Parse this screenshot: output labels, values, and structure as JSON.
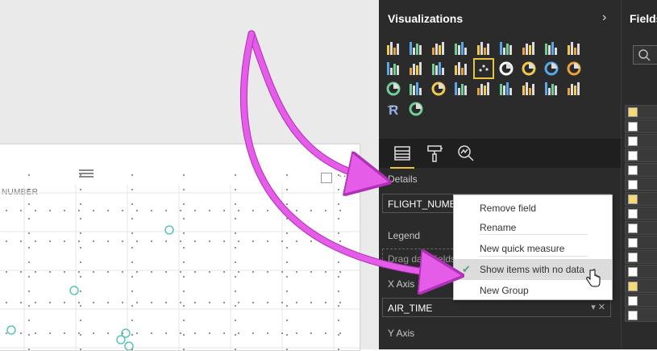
{
  "visualizations_pane": {
    "title": "Visualizations",
    "more_label": "...",
    "r_label": "R",
    "icons": [
      "stacked-bar-chart-icon",
      "stacked-column-chart-icon",
      "clustered-bar-chart-icon",
      "clustered-column-chart-icon",
      "100-stacked-bar-chart-icon",
      "100-stacked-column-chart-icon",
      "line-chart-icon",
      "area-chart-icon",
      "stacked-area-chart-icon",
      "line-and-stacked-column-icon",
      "line-and-clustered-column-icon",
      "ribbon-chart-icon",
      "waterfall-chart-icon",
      "scatter-chart-icon",
      "pie-chart-icon",
      "donut-chart-icon",
      "treemap-icon",
      "map-icon",
      "filled-map-icon",
      "funnel-icon",
      "gauge-icon",
      "card-icon",
      "multi-row-card-icon",
      "kpi-icon",
      "slicer-icon",
      "table-icon",
      "matrix-icon",
      "r-visual-icon",
      "arcgis-icon"
    ],
    "tabs": [
      "fields-tab",
      "format-tab",
      "analytics-tab"
    ]
  },
  "wells": {
    "details": {
      "label": "Details",
      "value": "FLIGHT_NUMBER"
    },
    "legend": {
      "label": "Legend",
      "placeholder": "Drag data fields here"
    },
    "x_axis": {
      "label": "X Axis",
      "value": "AIR_TIME"
    },
    "y_axis": {
      "label": "Y Axis"
    }
  },
  "context_menu": {
    "items": [
      "Remove field",
      "Rename",
      "New quick measure",
      "Show items with no data",
      "New Group"
    ],
    "checked_item": "Show items with no data"
  },
  "visual": {
    "axis_title": "NUMBER"
  },
  "fields_pane": {
    "title": "Fields"
  },
  "colors": {
    "pane_bg": "#2b2b2b",
    "accent": "#e8c33c",
    "arrow": "#e45ce8",
    "marker": "#3cc0b0"
  }
}
